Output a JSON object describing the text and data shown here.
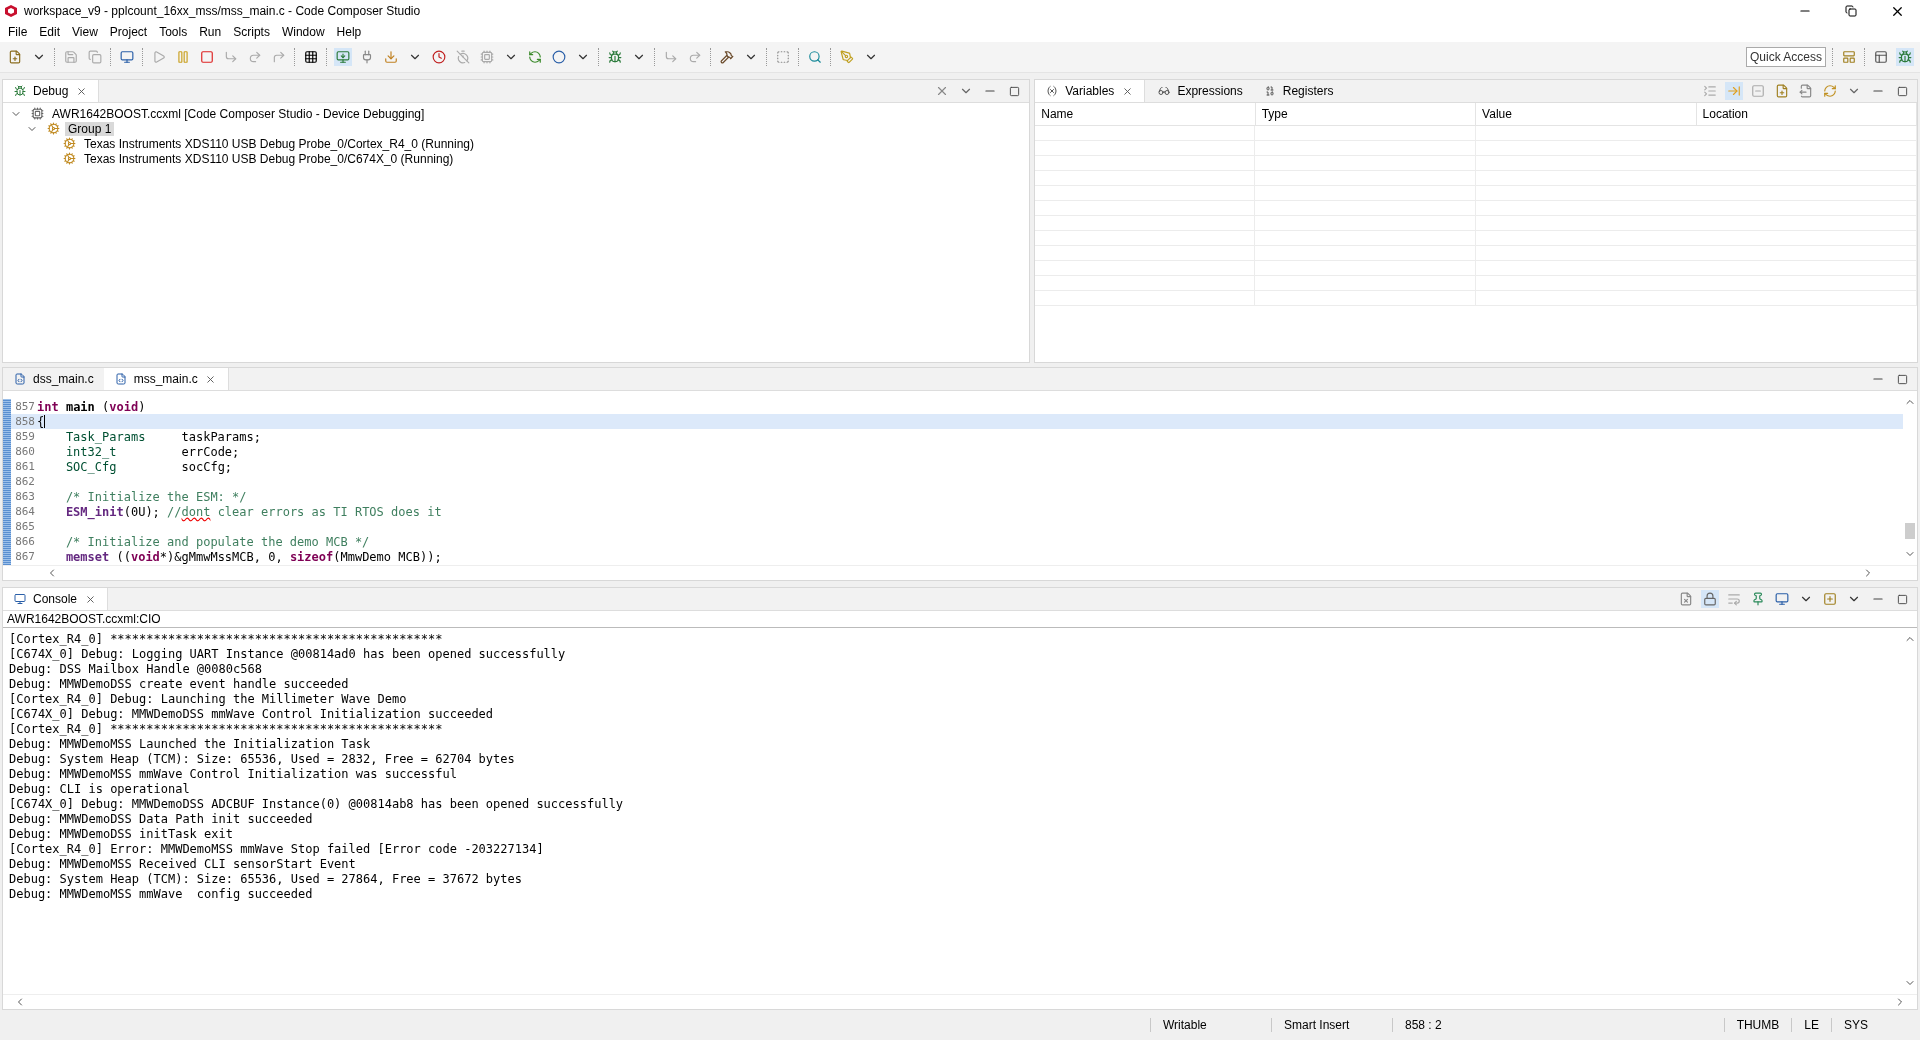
{
  "window": {
    "title": "workspace_v9 - pplcount_16xx_mss/mss_main.c - Code Composer Studio"
  },
  "menu": [
    "File",
    "Edit",
    "View",
    "Project",
    "Tools",
    "Run",
    "Scripts",
    "Window",
    "Help"
  ],
  "quick_access": {
    "placeholder": "Quick Access"
  },
  "debug_view": {
    "tab": "Debug",
    "tree": [
      {
        "label": "AWR1642BOOST.ccxml [Code Composer Studio - Device Debugging]",
        "expanded": true,
        "selected": false,
        "children": [
          {
            "label": "Group 1",
            "expanded": true,
            "selected": true,
            "children": [
              {
                "label": "Texas Instruments XDS110 USB Debug Probe_0/Cortex_R4_0 (Running)",
                "selected": false
              },
              {
                "label": "Texas Instruments XDS110 USB Debug Probe_0/C674X_0 (Running)",
                "selected": false
              }
            ]
          }
        ]
      }
    ]
  },
  "variables_view": {
    "tabs": [
      {
        "label": "Variables",
        "selected": true
      },
      {
        "label": "Expressions",
        "selected": false
      },
      {
        "label": "Registers",
        "selected": false
      }
    ],
    "columns": [
      "Name",
      "Type",
      "Value",
      "Location"
    ]
  },
  "editor": {
    "tabs": [
      {
        "label": "dss_main.c",
        "selected": false
      },
      {
        "label": "mss_main.c",
        "selected": true
      }
    ],
    "lines": [
      {
        "number": "857",
        "current": false,
        "segments": [
          {
            "text": "int ",
            "kind": "keyword"
          },
          {
            "text": "main",
            "kind": "bold"
          },
          {
            "text": " (",
            "kind": "plain"
          },
          {
            "text": "void",
            "kind": "keyword"
          },
          {
            "text": ")",
            "kind": "plain"
          }
        ]
      },
      {
        "number": "858",
        "current": true,
        "segments": [
          {
            "text": "{",
            "kind": "plain"
          }
        ]
      },
      {
        "number": "859",
        "current": false,
        "segments": [
          {
            "text": "    Task_Params",
            "kind": "type"
          },
          {
            "text": "     taskParams;",
            "kind": "plain"
          }
        ]
      },
      {
        "number": "860",
        "current": false,
        "segments": [
          {
            "text": "    int32_t",
            "kind": "type"
          },
          {
            "text": "         errCode;",
            "kind": "plain"
          }
        ]
      },
      {
        "number": "861",
        "current": false,
        "segments": [
          {
            "text": "    SOC_Cfg",
            "kind": "type"
          },
          {
            "text": "         socCfg;",
            "kind": "plain"
          }
        ]
      },
      {
        "number": "862",
        "current": false
      },
      {
        "number": "863",
        "current": false,
        "segments": [
          {
            "text": "    /* Initialize the ESM: */",
            "kind": "comment"
          }
        ]
      },
      {
        "number": "864",
        "current": false,
        "segments": [
          {
            "text": "    ESM_init",
            "kind": "function"
          },
          {
            "text": "(0U); ",
            "kind": "plain"
          },
          {
            "text": "//",
            "kind": "comment"
          },
          {
            "text": "dont",
            "kind": "misspelled"
          },
          {
            "text": " clear errors as TI RTOS does it",
            "kind": "comment"
          }
        ]
      },
      {
        "number": "865",
        "current": false
      },
      {
        "number": "866",
        "current": false,
        "segments": [
          {
            "text": "    /* Initialize and populate the demo MCB */",
            "kind": "comment"
          }
        ]
      },
      {
        "number": "867",
        "current": false,
        "segments": [
          {
            "text": "    memset",
            "kind": "function"
          },
          {
            "text": " ((",
            "kind": "plain"
          },
          {
            "text": "void",
            "kind": "keyword"
          },
          {
            "text": "*)&gMmwMssMCB, 0, ",
            "kind": "plain"
          },
          {
            "text": "sizeof",
            "kind": "keyword"
          },
          {
            "text": "(MmwDemo MCB));",
            "kind": "plain"
          }
        ]
      }
    ]
  },
  "console": {
    "tab": "Console",
    "source": "AWR1642BOOST.ccxml:CIO",
    "lines": [
      "[Cortex_R4_0] **********************************************",
      "[C674X_0] Debug: Logging UART Instance @00814ad0 has been opened successfully",
      "Debug: DSS Mailbox Handle @0080c568",
      "Debug: MMWDemoDSS create event handle succeeded",
      "[Cortex_R4_0] Debug: Launching the Millimeter Wave Demo",
      "[C674X_0] Debug: MMWDemoDSS mmWave Control Initialization succeeded",
      "[Cortex_R4_0] **********************************************",
      "Debug: MMWDemoMSS Launched the Initialization Task",
      "Debug: System Heap (TCM): Size: 65536, Used = 2832, Free = 62704 bytes",
      "Debug: MMWDemoMSS mmWave Control Initialization was successful",
      "Debug: CLI is operational",
      "[C674X_0] Debug: MMWDemoDSS ADCBUF Instance(0) @00814ab8 has been opened successfully",
      "Debug: MMWDemoDSS Data Path init succeeded",
      "Debug: MMWDemoDSS initTask exit",
      "[Cortex_R4_0] Error: MMWDemoMSS mmWave Stop failed [Error code -203227134]",
      "Debug: MMWDemoMSS Received CLI sensorStart Event",
      "Debug: System Heap (TCM): Size: 65536, Used = 27864, Free = 37672 bytes",
      "Debug: MMWDemoMSS mmWave  config succeeded"
    ]
  },
  "status_bar": {
    "left": [
      "Writable",
      "Smart Insert",
      "858 : 2"
    ],
    "right": [
      "THUMB",
      "LE",
      "SYS"
    ]
  }
}
